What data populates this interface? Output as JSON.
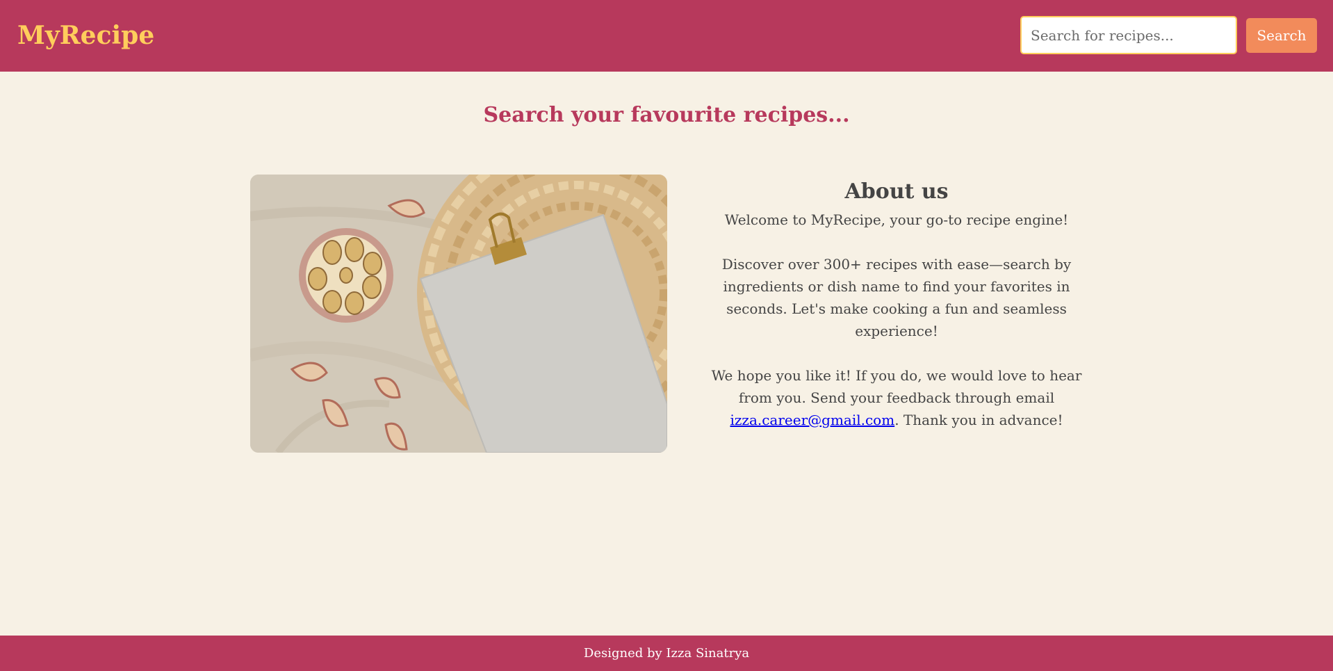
{
  "header": {
    "logo": "MyRecipe",
    "search_placeholder": "Search for recipes...",
    "search_button": "Search"
  },
  "main": {
    "heading": "Search your favourite recipes...",
    "image_description": "recipe-card-garlic-photo"
  },
  "about": {
    "title": "About us",
    "welcome": "Welcome to MyRecipe, your go-to recipe engine!",
    "discover": "Discover over 300+ recipes with ease—search by ingredients or dish name to find your favorites in seconds. Let's make cooking a fun and seamless experience!",
    "feedback_prefix": "We hope you like it! If you do, we would love to hear from you. Send your feedback through email ",
    "email": "izza.career@gmail.com",
    "feedback_suffix": ". Thank you in advance!"
  },
  "footer": {
    "credit": "Designed by Izza Sinatrya"
  },
  "colors": {
    "brand": "#b7395c",
    "logo": "#ffce5c",
    "button": "#f28b5b",
    "background": "#f7f1e5",
    "text": "#444444",
    "link": "#0000ee"
  }
}
